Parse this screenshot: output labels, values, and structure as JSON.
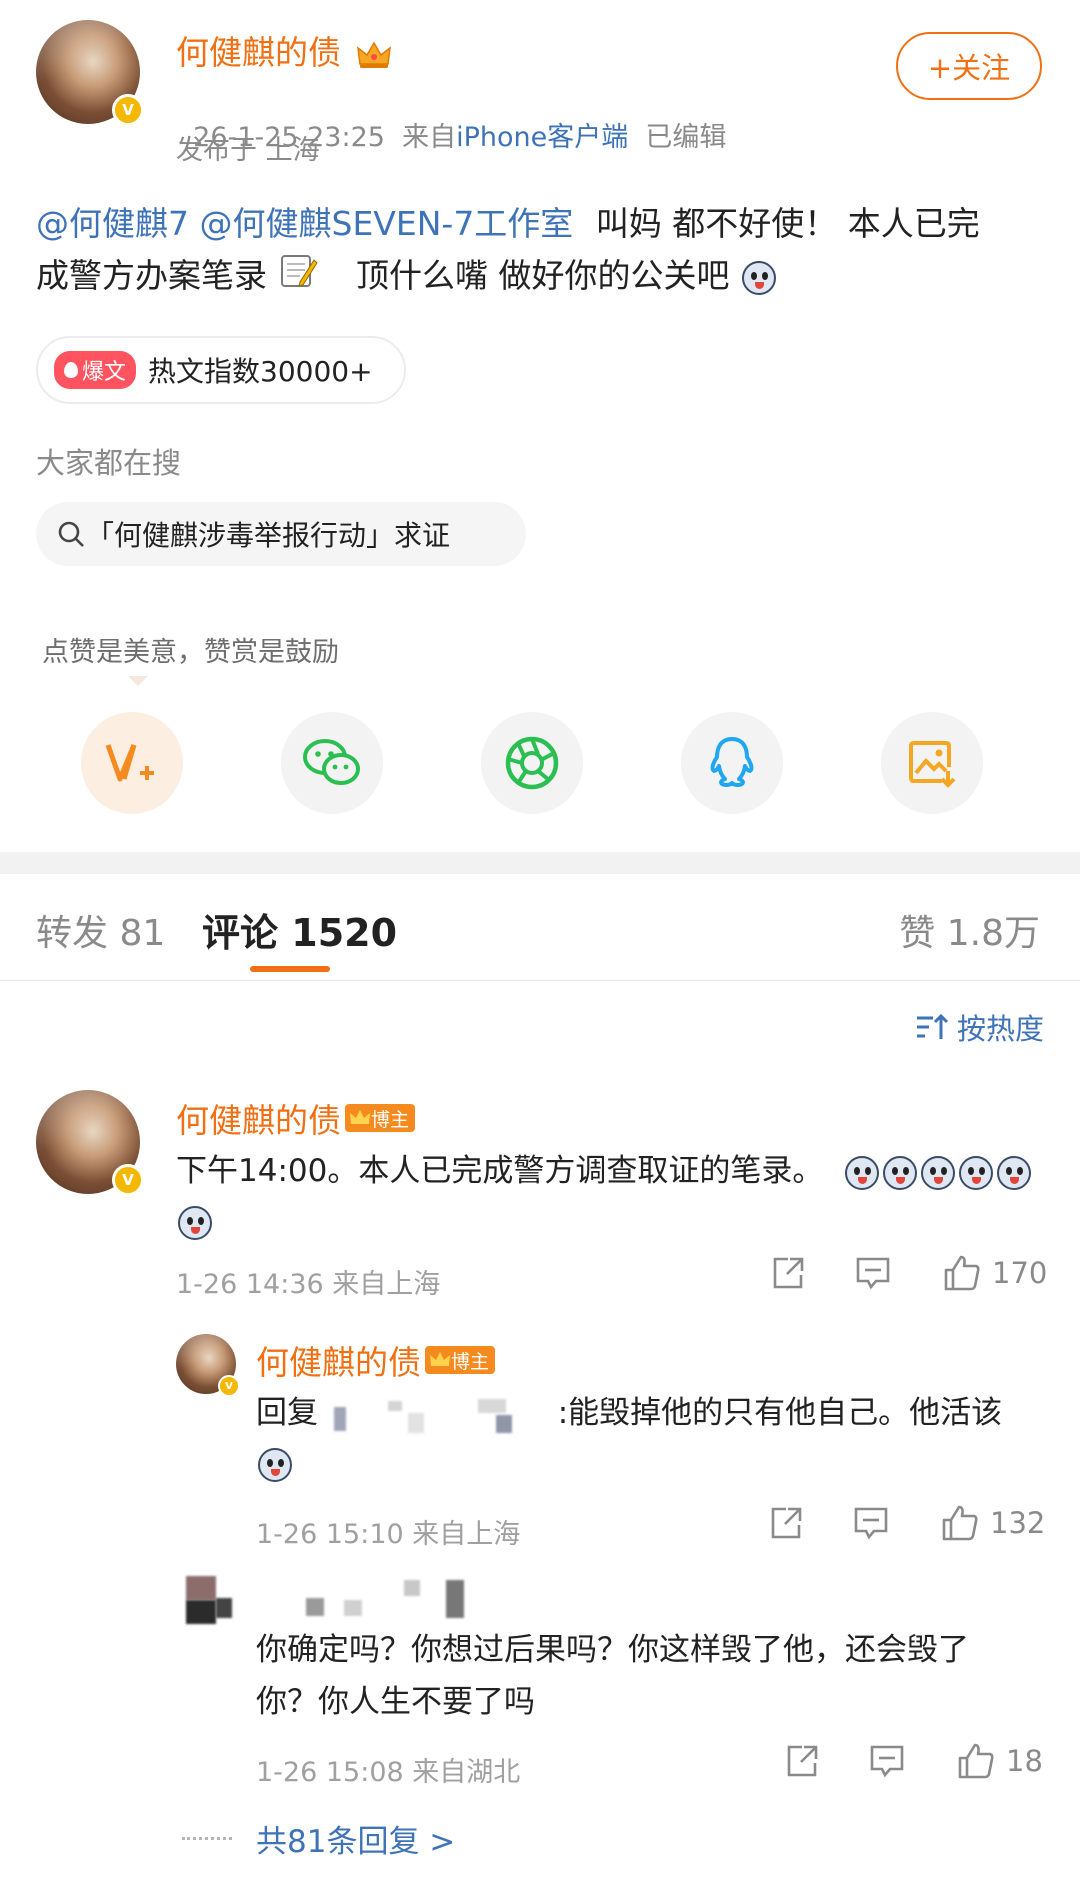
{
  "post": {
    "author": "何健麒的债",
    "meta_line": "26-1-25 23:25  来自",
    "source": "iPhone客户端",
    "edited": "已编辑",
    "location": "发布于 上海",
    "follow_label": "+关注",
    "mention1": "@何健麒7",
    "mention2": "@何健麒SEVEN-7工作室",
    "text1": "叫妈 都不好使！ 本人已完",
    "text2": "成警方办案笔录",
    "text3": "顶什么嘴 做好你的公关吧",
    "hot_badge": "爆文",
    "hot_text": "热文指数30000+",
    "search_heading": "大家都在搜",
    "search_term": "「何健麒涉毒举报行动」求证",
    "reward_hint": "点赞是美意，赞赏是鼓励"
  },
  "share": {
    "icons": [
      "v-plus-icon",
      "wechat-icon",
      "moments-icon",
      "qq-icon",
      "save-image-icon"
    ],
    "colors": {
      "v": "#f58b1f",
      "wechat": "#2bbf52",
      "moments": "#2bbf52",
      "qq": "#1fa8f0",
      "save": "#f5a623"
    }
  },
  "tabs": {
    "repost": "转发 81",
    "comments_label": "评论",
    "comments_count": "1520",
    "likes": "赞 1.8万",
    "sort_label": "按热度"
  },
  "comments": [
    {
      "author": "何健麒的债",
      "badge": "博主",
      "text": "下午14:00。本人已完成警方调查取证的笔录。",
      "time": "1-26 14:36 来自上海",
      "likes": "170"
    },
    {
      "author": "何健麒的债",
      "badge": "博主",
      "reply_prefix": "回复",
      "text": ":能毁掉他的只有他自己。他活该",
      "time": "1-26 15:10 来自上海",
      "likes": "132"
    },
    {
      "text": "你确定吗？你想过后果吗？你这样毁了他，还会毁了",
      "text2": "你？你人生不要了吗",
      "time": "1-26 15:08 来自湖北",
      "likes": "18"
    }
  ],
  "more_replies": "共81条回复 >",
  "colors": {
    "accent_orange": "#f07013",
    "link_blue": "#3f73b8",
    "grey": "#8a8a8a",
    "badge_orange": "#f58b1f"
  }
}
